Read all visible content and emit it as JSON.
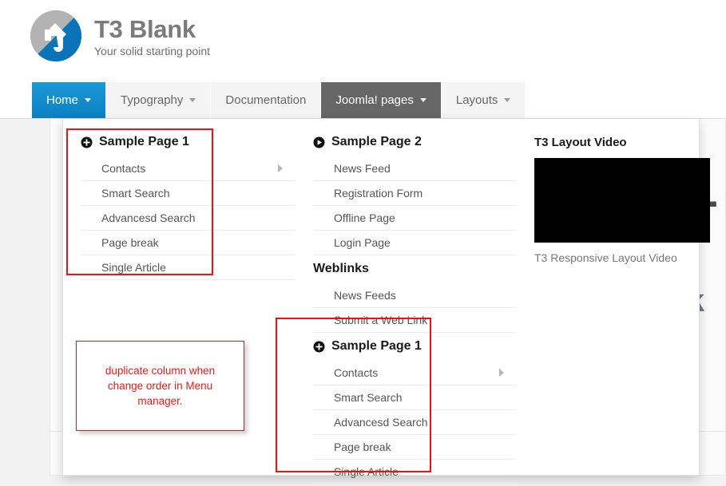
{
  "site": {
    "logo_icon": "t3-logo-icon",
    "title": "T3 Blank",
    "slogan": "Your solid starting point"
  },
  "navbar": {
    "items": [
      {
        "label": "Home",
        "has_caret": true,
        "state": "active"
      },
      {
        "label": "Typography",
        "has_caret": true,
        "state": "default"
      },
      {
        "label": "Documentation",
        "has_caret": false,
        "state": "default"
      },
      {
        "label": "Joomla! pages",
        "has_caret": true,
        "state": "hovered"
      },
      {
        "label": "Layouts",
        "has_caret": true,
        "state": "default"
      }
    ]
  },
  "background_page": {
    "heading": "T",
    "subheading": "k"
  },
  "dropdown": {
    "column1": {
      "heading": {
        "label": "Sample Page 1",
        "icon": "plus-circle-icon"
      },
      "items": [
        {
          "label": "Contacts",
          "has_submenu": true
        },
        {
          "label": "Smart Search",
          "has_submenu": false
        },
        {
          "label": "Advancesd Search",
          "has_submenu": false
        },
        {
          "label": "Page break",
          "has_submenu": false
        },
        {
          "label": "Single Article",
          "has_submenu": false
        }
      ]
    },
    "column2": {
      "group1": {
        "heading": {
          "label": "Sample Page 2",
          "icon": "play-circle-icon"
        },
        "items": [
          {
            "label": "News Feed",
            "has_submenu": false
          },
          {
            "label": "Registration Form",
            "has_submenu": false
          },
          {
            "label": "Offline Page",
            "has_submenu": false
          },
          {
            "label": "Login Page",
            "has_submenu": false
          }
        ]
      },
      "group2": {
        "heading": {
          "label": "Weblinks",
          "icon": "none"
        },
        "items": [
          {
            "label": "News Feeds",
            "has_submenu": false
          },
          {
            "label": "Submit a Web Link",
            "has_submenu": false
          }
        ]
      },
      "group3": {
        "heading": {
          "label": "Sample Page 1",
          "icon": "plus-circle-icon"
        },
        "items": [
          {
            "label": "Contacts",
            "has_submenu": true
          },
          {
            "label": "Smart Search",
            "has_submenu": false
          },
          {
            "label": "Advancesd Search",
            "has_submenu": false
          },
          {
            "label": "Page break",
            "has_submenu": false
          },
          {
            "label": "Single Article",
            "has_submenu": false
          }
        ]
      }
    },
    "column3": {
      "title": "T3 Layout Video",
      "video_placeholder": "video-player",
      "caption": "T3 Responsive Layout Video"
    }
  },
  "annotations": {
    "note": "duplicate column when change order in Menu manager.",
    "highlight_color": "#ee1111"
  }
}
